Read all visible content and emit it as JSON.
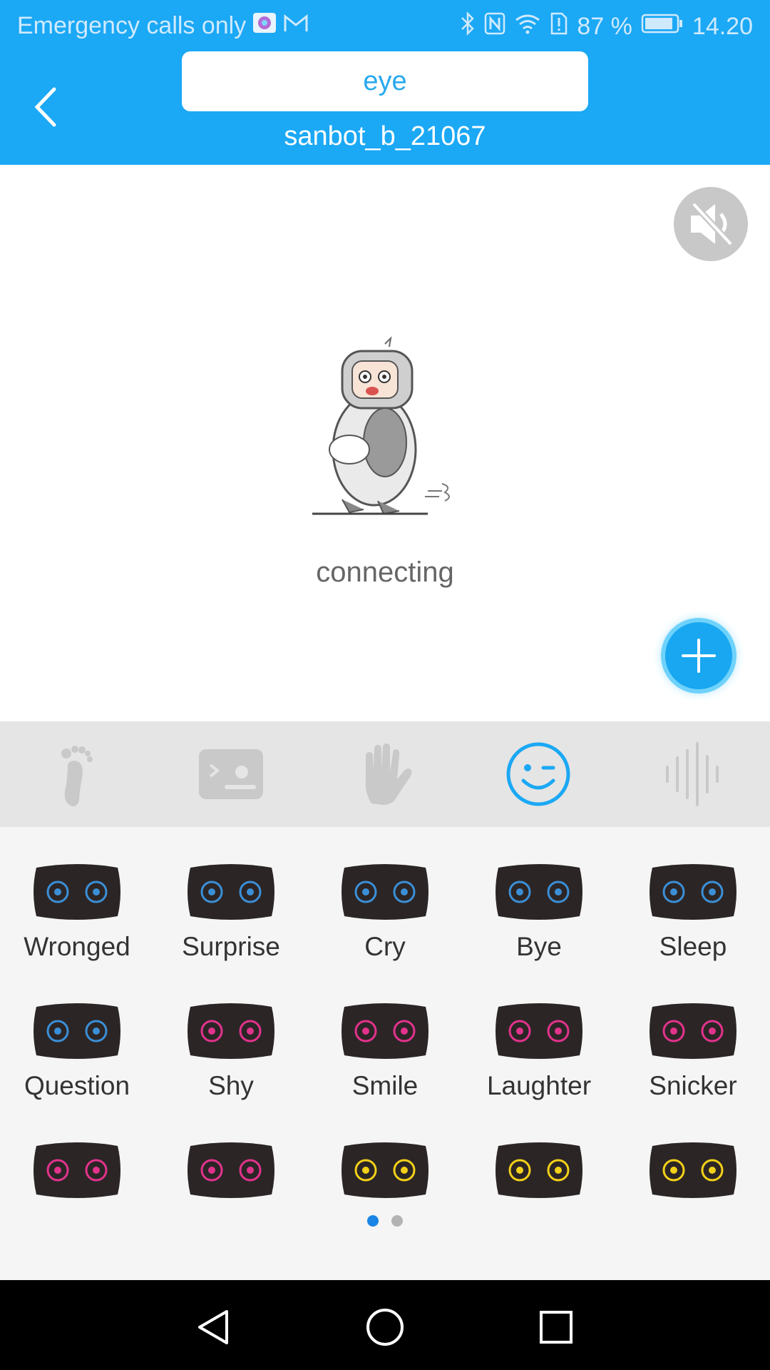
{
  "status_bar": {
    "carrier": "Emergency calls only",
    "battery": "87 %",
    "time": "14.20"
  },
  "header": {
    "mode_title": "eye",
    "device_name": "sanbot_b_21067"
  },
  "main": {
    "status_text": "connecting"
  },
  "tabs": [
    {
      "icon": "footprint-icon",
      "active": false
    },
    {
      "icon": "screen-card-icon",
      "active": false
    },
    {
      "icon": "hand-icon",
      "active": false
    },
    {
      "icon": "wink-face-icon",
      "active": true
    },
    {
      "icon": "sound-wave-icon",
      "active": false
    }
  ],
  "expressions": [
    {
      "label": "Wronged",
      "color": "#3b8fd6"
    },
    {
      "label": "Surprise",
      "color": "#3b8fd6"
    },
    {
      "label": "Cry",
      "color": "#3b8fd6"
    },
    {
      "label": "Bye",
      "color": "#3b8fd6"
    },
    {
      "label": "Sleep",
      "color": "#3b8fd6"
    },
    {
      "label": "Question",
      "color": "#3b8fd6"
    },
    {
      "label": "Shy",
      "color": "#e2338c"
    },
    {
      "label": "Smile",
      "color": "#e2338c"
    },
    {
      "label": "Laughter",
      "color": "#e2338c"
    },
    {
      "label": "Snicker",
      "color": "#e2338c"
    },
    {
      "label": "",
      "color": "#e2338c"
    },
    {
      "label": "",
      "color": "#e2338c"
    },
    {
      "label": "",
      "color": "#f3d019"
    },
    {
      "label": "",
      "color": "#f3d019"
    },
    {
      "label": "",
      "color": "#f3d019"
    }
  ],
  "pager": {
    "current": 1,
    "total": 2
  },
  "colors": {
    "header": "#1ba8f5",
    "accent": "#18a7f0"
  }
}
